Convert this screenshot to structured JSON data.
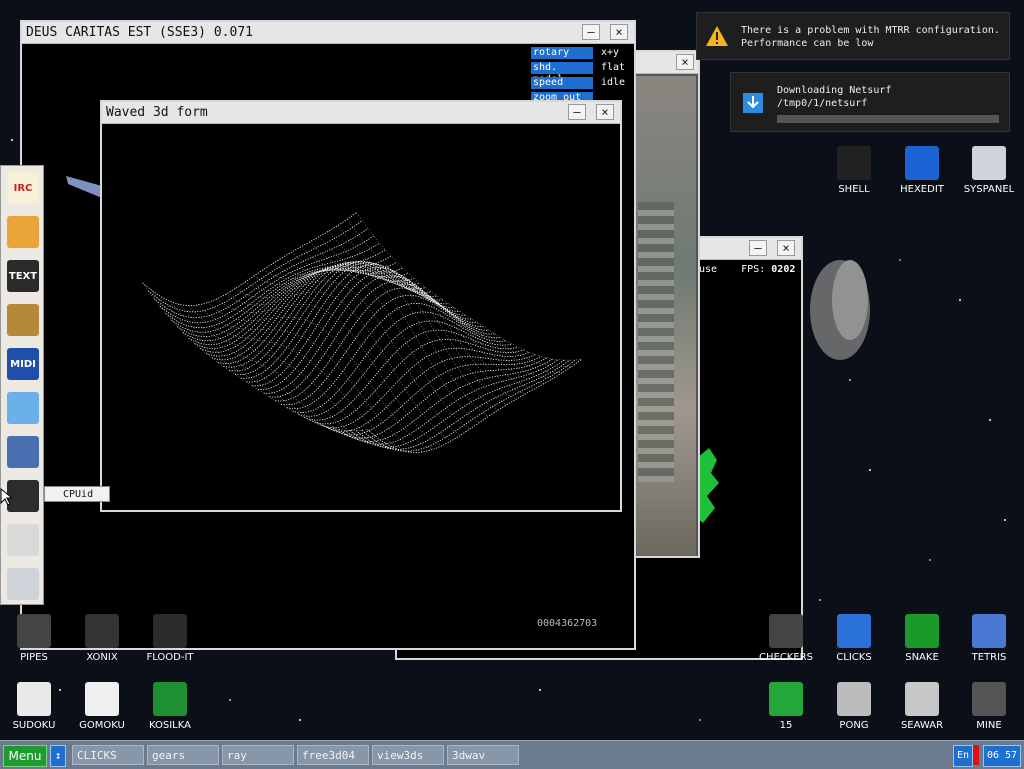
{
  "windows": {
    "deus": {
      "title": "DEUS CARITAS EST (SSE3) 0.071",
      "controls": [
        {
          "label": "rotary",
          "value": "x+y"
        },
        {
          "label": "shd. model",
          "value": "flat"
        },
        {
          "label": "speed",
          "value": "idle"
        },
        {
          "label": "zoom out",
          "value": ""
        }
      ],
      "counter": "0004362703"
    },
    "waved": {
      "title": "Waved 3d form"
    },
    "gears": {
      "fps_label": "FPS:",
      "fps_value": "0202",
      "partial_text": "use"
    }
  },
  "buttons": {
    "minimize": "–",
    "close": "×"
  },
  "tooltip": "CPUid",
  "notifications": [
    {
      "icon": "warning-icon",
      "line1": "There is a problem with MTRR configuration.",
      "line2": "Performance can be low"
    },
    {
      "icon": "download-icon",
      "line1": "Downloading Netsurf",
      "line2": "/tmp0/1/netsurf"
    }
  ],
  "download_progress": 0.0,
  "desktop_icons": {
    "right_top": [
      {
        "label": "SHELL",
        "icon": "shell-icon"
      },
      {
        "label": "HEXEDIT",
        "icon": "hexedit-icon"
      },
      {
        "label": "SYSPANEL",
        "icon": "syspanel-icon"
      }
    ],
    "left_row": [
      {
        "label": "PIPES",
        "icon": "pipes-icon"
      },
      {
        "label": "XONIX",
        "icon": "xonix-icon"
      },
      {
        "label": "FLOOD-IT",
        "icon": "flood-it-icon"
      }
    ],
    "left_bottom": [
      {
        "label": "SUDOKU",
        "icon": "sudoku-icon"
      },
      {
        "label": "GOMOKU",
        "icon": "gomoku-icon"
      },
      {
        "label": "KOSILKA",
        "icon": "kosilka-icon"
      }
    ],
    "right_row": [
      {
        "label": "CHECKERS",
        "icon": "checkers-icon"
      },
      {
        "label": "CLICKS",
        "icon": "clicks-icon"
      },
      {
        "label": "SNAKE",
        "icon": "snake-icon"
      },
      {
        "label": "TETRIS",
        "icon": "tetris-icon"
      }
    ],
    "right_bottom": [
      {
        "label": "15",
        "icon": "fifteen-icon"
      },
      {
        "label": "PONG",
        "icon": "pong-icon"
      },
      {
        "label": "SEAWAR",
        "icon": "seawar-icon"
      },
      {
        "label": "MINE",
        "icon": "mine-icon"
      }
    ]
  },
  "sidepanel": [
    {
      "icon": "irc-icon",
      "text": "IRC"
    },
    {
      "icon": "package-icon",
      "text": ""
    },
    {
      "icon": "text-editor-icon",
      "text": "TEXT"
    },
    {
      "icon": "speaker-icon",
      "text": ""
    },
    {
      "icon": "midi-player-icon",
      "text": "MIDI"
    },
    {
      "icon": "image-viewer-icon",
      "text": ""
    },
    {
      "icon": "hardware-icon",
      "text": ""
    },
    {
      "icon": "cpu-icon",
      "text": ""
    },
    {
      "icon": "volume-icon",
      "text": ""
    },
    {
      "icon": "settings-sliders-icon",
      "text": ""
    }
  ],
  "taskbar": {
    "menu": "Menu",
    "tasks": [
      "CLICKS",
      "gears",
      "ray",
      "free3d04",
      "view3ds",
      "3dwav"
    ],
    "lang": "En",
    "time": "06 57"
  }
}
